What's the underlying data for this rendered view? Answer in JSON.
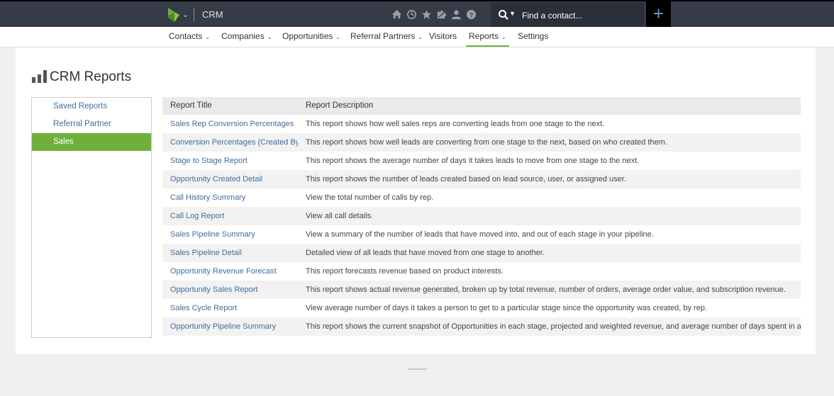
{
  "header": {
    "app_name": "CRM",
    "search": {
      "placeholder": "Find a contact..."
    },
    "add_label": "+",
    "icons": [
      "home-icon",
      "clock-icon",
      "star-icon",
      "puzzle-icon",
      "user-icon",
      "help-icon"
    ],
    "brand_color": "#6fb03a"
  },
  "nav": {
    "items": [
      {
        "label": "Contacts",
        "has_menu": true
      },
      {
        "label": "Companies",
        "has_menu": true
      },
      {
        "label": "Opportunities",
        "has_menu": true
      },
      {
        "label": "Referral Partners",
        "has_menu": true
      },
      {
        "label": "Visitors",
        "has_menu": false
      },
      {
        "label": "Reports",
        "has_menu": true,
        "active": true
      },
      {
        "label": "Settings",
        "has_menu": false
      }
    ]
  },
  "page": {
    "title": "CRM Reports"
  },
  "sidebar": {
    "items": [
      {
        "label": "Saved Reports"
      },
      {
        "label": "Referral Partner"
      },
      {
        "label": "Sales",
        "active": true
      }
    ]
  },
  "table": {
    "headers": [
      "Report Title",
      "Report Description"
    ],
    "rows": [
      {
        "title": "Sales Rep Conversion Percentages",
        "desc": "This report shows how well sales reps are converting leads from one stage to the next."
      },
      {
        "title": "Conversion Percentages (Created By)",
        "desc": "This report shows how well leads are converting from one stage to the next, based on who created them."
      },
      {
        "title": "Stage to Stage Report",
        "desc": "This report shows the average number of days it takes leads to move from one stage to the next."
      },
      {
        "title": "Opportunity Created Detail",
        "desc": "This report shows the number of leads created based on lead source, user, or assigned user."
      },
      {
        "title": "Call History Summary",
        "desc": "View the total number of calls by rep."
      },
      {
        "title": "Call Log Report",
        "desc": "View all call details."
      },
      {
        "title": "Sales Pipeline Summary",
        "desc": "View a summary of the number of leads that have moved into, and out of each stage in your pipeline."
      },
      {
        "title": "Sales Pipeline Detail",
        "desc": "Detailed view of all leads that have moved from one stage to another."
      },
      {
        "title": "Opportunity Revenue Forecast",
        "desc": "This report forecasts revenue based on product interests."
      },
      {
        "title": "Opportunity Sales Report",
        "desc": "This report shows actual revenue generated, broken up by total revenue, number of orders, average order value, and subscription revenue."
      },
      {
        "title": "Sales Cycle Report",
        "desc": "View average number of days it takes a person to get to a particular stage since the opportunity was created, by rep."
      },
      {
        "title": "Opportunity Pipeline Summary",
        "desc": "This report shows the current snapshot of Opportunities in each stage, projected and weighted revenue, and average number of days spent in a stage."
      }
    ]
  }
}
